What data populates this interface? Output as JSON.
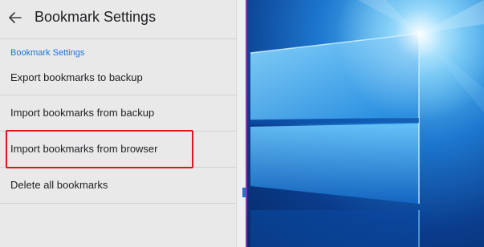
{
  "header": {
    "title": "Bookmark Settings"
  },
  "section": {
    "header": "Bookmark Settings"
  },
  "items": [
    {
      "label": "Export bookmarks to backup"
    },
    {
      "label": "Import bookmarks from backup"
    },
    {
      "label": "Import bookmarks from browser"
    },
    {
      "label": "Delete all bookmarks"
    }
  ],
  "colors": {
    "accent": "#1976d2",
    "highlight": "#e0151b",
    "panel_bg": "#e9e9ea"
  },
  "icons": {
    "back": "arrow-back-icon"
  }
}
